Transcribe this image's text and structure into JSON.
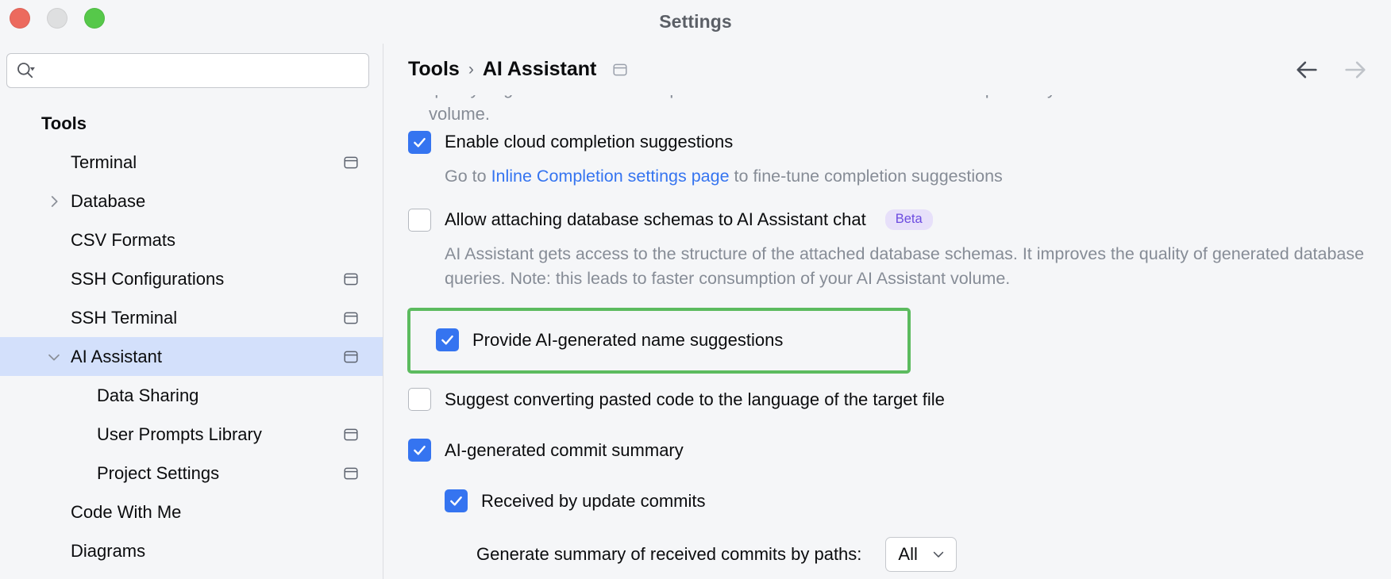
{
  "window": {
    "title": "Settings",
    "traffic_lights": [
      "close-red",
      "minimize-gray",
      "zoom-green"
    ]
  },
  "sidebar": {
    "search": {
      "value": "",
      "placeholder": ""
    },
    "group_title": "Tools",
    "items": [
      {
        "label": "Terminal",
        "indent": 1,
        "arrow": "none",
        "badge": true,
        "selected": false
      },
      {
        "label": "Database",
        "indent": 1,
        "arrow": "collapsed",
        "badge": false,
        "selected": false
      },
      {
        "label": "CSV Formats",
        "indent": 1,
        "arrow": "none",
        "badge": false,
        "selected": false
      },
      {
        "label": "SSH Configurations",
        "indent": 1,
        "arrow": "none",
        "badge": true,
        "selected": false
      },
      {
        "label": "SSH Terminal",
        "indent": 1,
        "arrow": "none",
        "badge": true,
        "selected": false
      },
      {
        "label": "AI Assistant",
        "indent": 1,
        "arrow": "expanded",
        "badge": true,
        "selected": true
      },
      {
        "label": "Data Sharing",
        "indent": 2,
        "arrow": "none",
        "badge": false,
        "selected": false
      },
      {
        "label": "User Prompts Library",
        "indent": 2,
        "arrow": "none",
        "badge": true,
        "selected": false
      },
      {
        "label": "Project Settings",
        "indent": 2,
        "arrow": "none",
        "badge": true,
        "selected": false
      },
      {
        "label": "Code With Me",
        "indent": 1,
        "arrow": "none",
        "badge": false,
        "selected": false
      },
      {
        "label": "Diagrams",
        "indent": 1,
        "arrow": "none",
        "badge": false,
        "selected": false
      }
    ]
  },
  "header": {
    "breadcrumb_root": "Tools",
    "breadcrumb_sep": "›",
    "breadcrumb_current": "AI Assistant",
    "back_label": "Back",
    "forward_label": "Forward"
  },
  "content": {
    "clipped_top_text": "quality of generated database queries. Note: this leads to faster consumption of your AI Assistant\nvolume.",
    "cloud_completion": {
      "label": "Enable cloud completion suggestions",
      "checked": true,
      "desc_before": "Go to ",
      "desc_link": "Inline Completion settings page",
      "desc_after": " to fine-tune completion suggestions"
    },
    "attach_schemas": {
      "label": "Allow attaching database schemas to AI Assistant chat",
      "checked": false,
      "badge": "Beta",
      "desc": "AI Assistant gets access to the structure of the attached database schemas. It improves the quality of generated database queries. Note: this leads to faster consumption of your AI Assistant volume."
    },
    "name_suggestions": {
      "label": "Provide AI-generated name suggestions",
      "checked": true,
      "highlighted": true
    },
    "convert_pasted_code": {
      "label": "Suggest converting pasted code to the language of the target file",
      "checked": false
    },
    "commit_summary": {
      "label": "AI-generated commit summary",
      "checked": true
    },
    "received_commits": {
      "label": "Received by update commits",
      "checked": true
    },
    "summary_paths": {
      "label": "Generate summary of received commits by paths:",
      "value": "All"
    }
  },
  "colors": {
    "accent_blue": "#3574f0",
    "highlight_green": "#5cbb5f",
    "selection_blue": "#d3e0fb",
    "beta_bg": "#e7e0fa",
    "beta_fg": "#6c4ce0",
    "muted_text": "#868c96"
  }
}
